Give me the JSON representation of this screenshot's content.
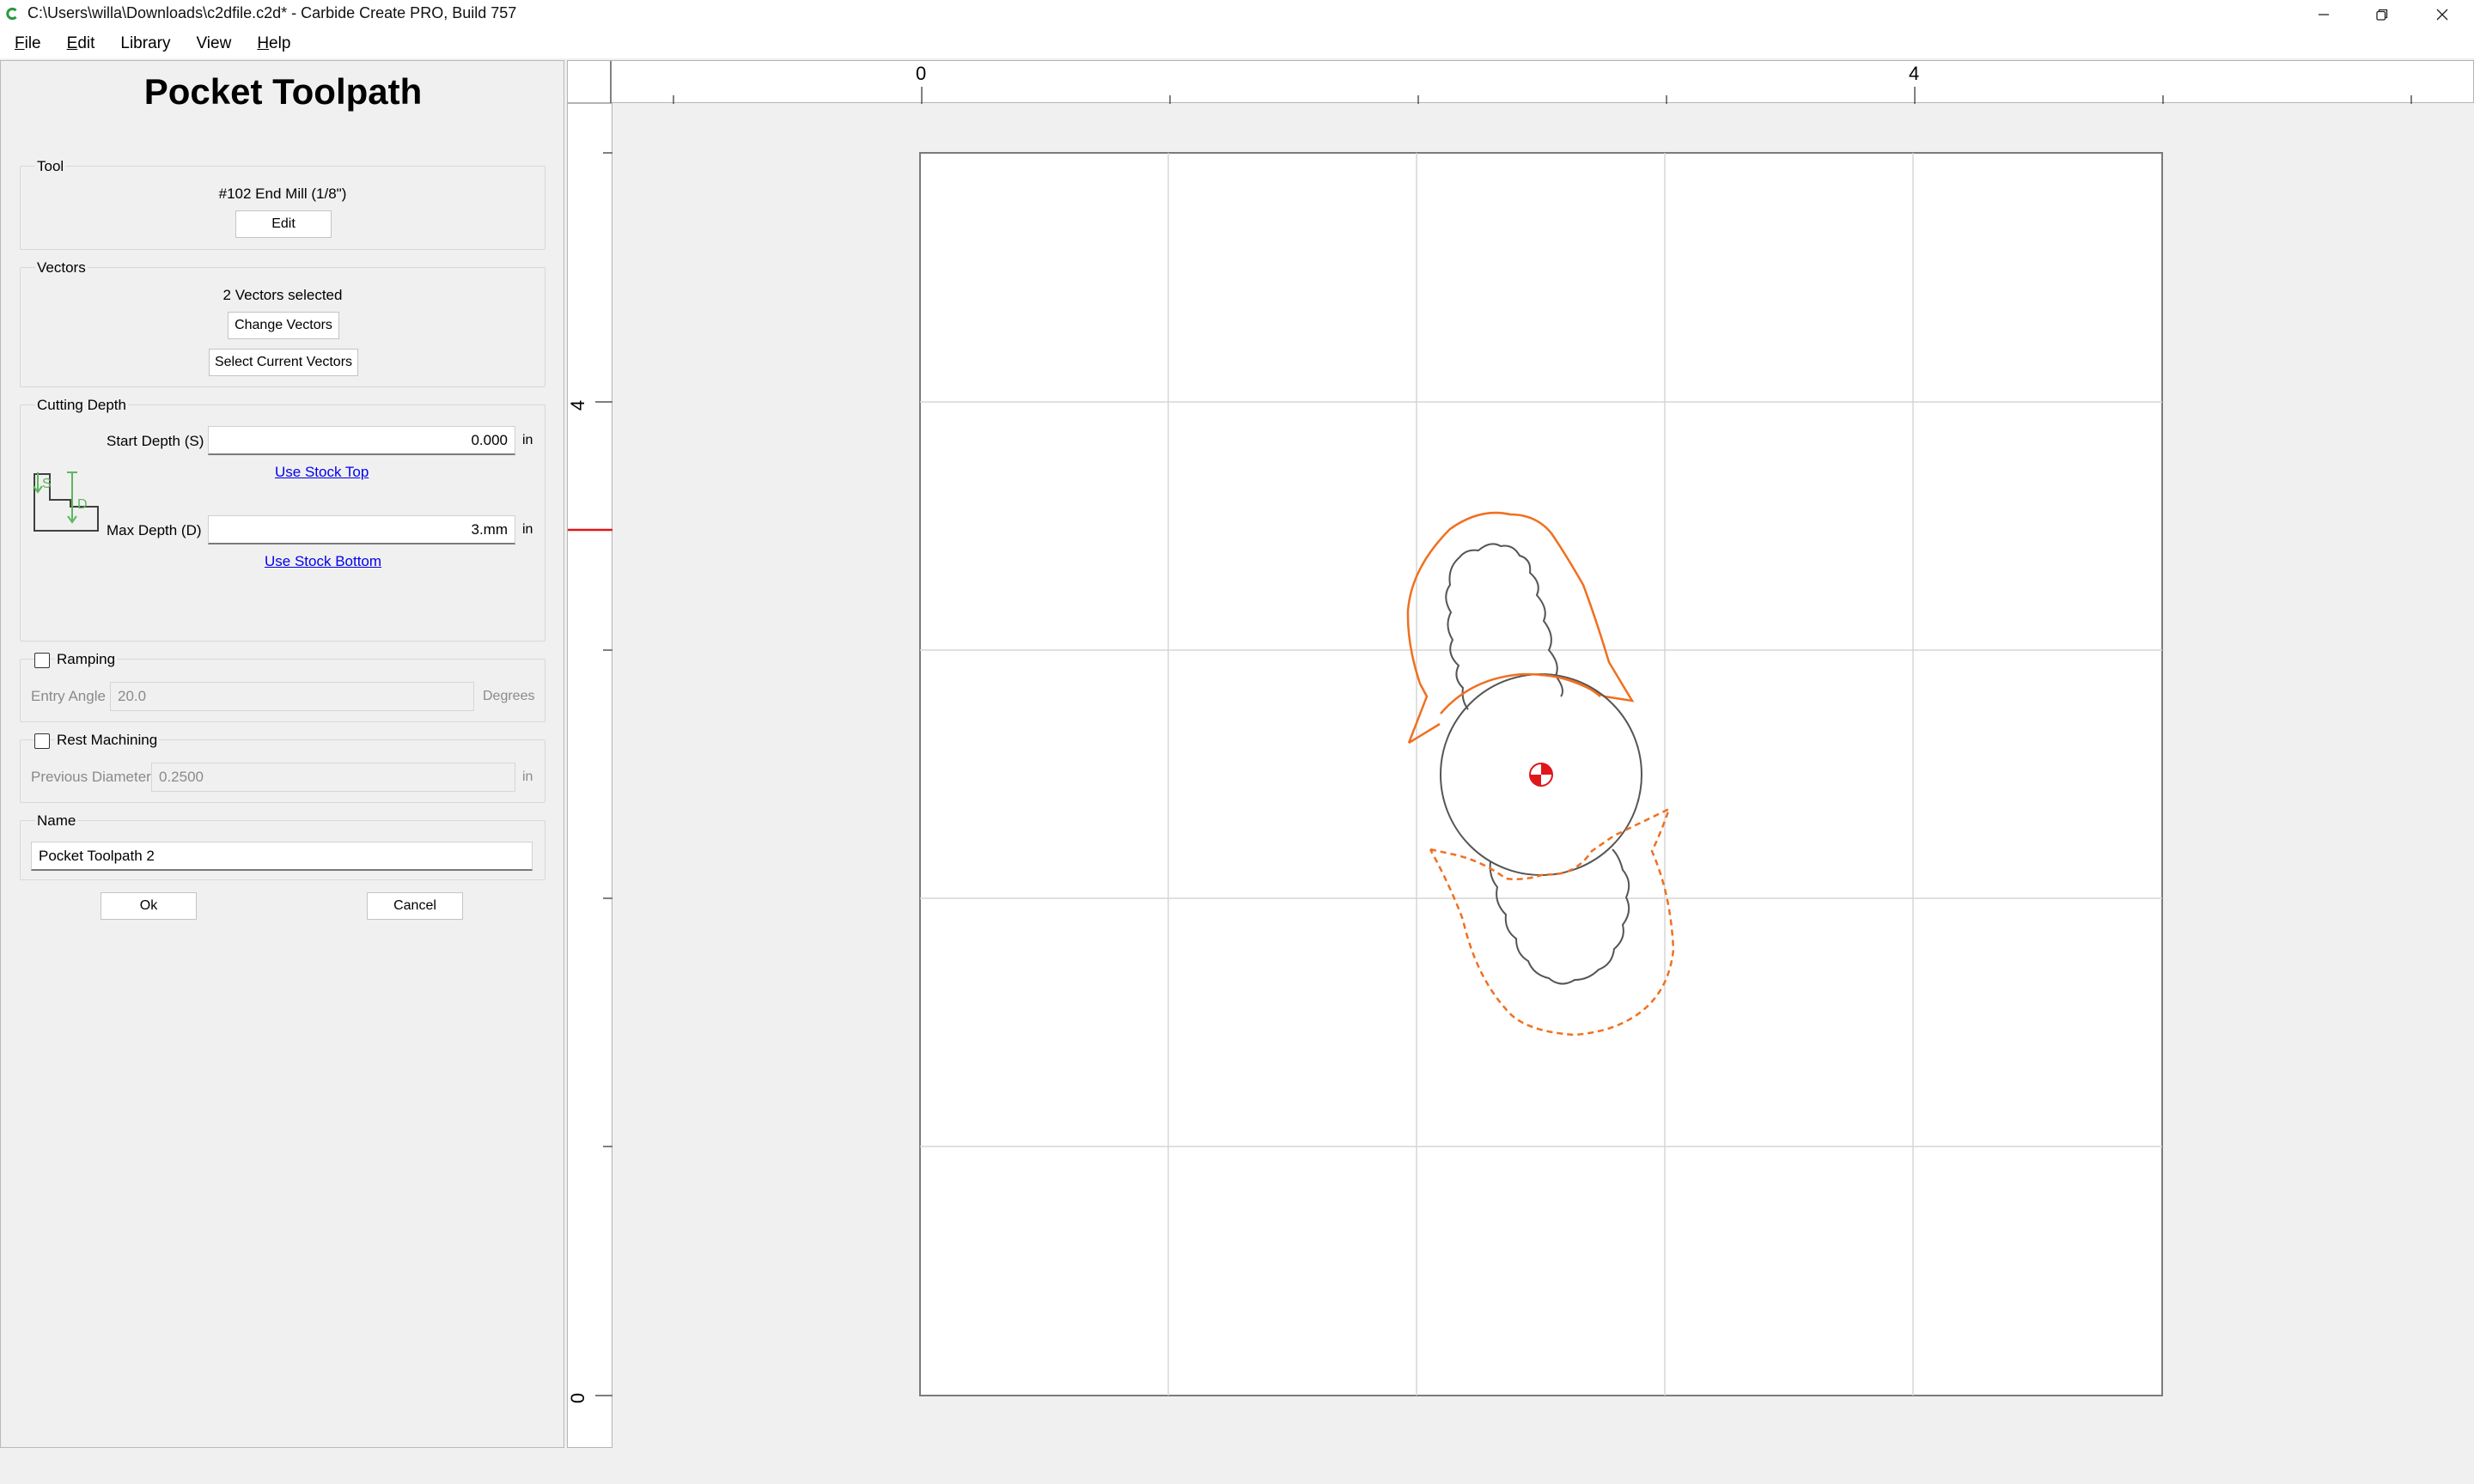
{
  "window": {
    "title": "C:\\Users\\willa\\Downloads\\c2dfile.c2d* - Carbide Create PRO, Build 757",
    "controls": [
      "minimize-icon",
      "restore-icon",
      "close-icon"
    ],
    "accent_color": "#2b9a3d"
  },
  "menu": {
    "items": [
      {
        "mnemonic": "F",
        "rest": "ile"
      },
      {
        "mnemonic": "E",
        "rest": "dit"
      },
      {
        "mnemonic": "",
        "rest": "Library"
      },
      {
        "mnemonic": "",
        "rest": "View"
      },
      {
        "mnemonic": "H",
        "rest": "elp"
      }
    ]
  },
  "panel": {
    "title": "Pocket Toolpath",
    "tool": {
      "label": "Tool",
      "name": "#102 End Mill (1/8\")",
      "edit_button": "Edit"
    },
    "vectors": {
      "label": "Vectors",
      "selected_text": "2 Vectors selected",
      "change_button": "Change Vectors",
      "select_button": "Select Current Vectors"
    },
    "cutting_depth": {
      "label": "Cutting Depth",
      "start_label": "Start Depth (S)",
      "start_value": "0.000",
      "start_unit": "in",
      "use_stock_top": "Use Stock Top",
      "max_label": "Max Depth (D)",
      "max_value": "3.mm",
      "max_unit": "in",
      "use_stock_bottom": "Use Stock Bottom",
      "diagram_s": "S",
      "diagram_d": "D"
    },
    "ramping": {
      "label": "Ramping",
      "checked": false,
      "entry_angle_label": "Entry Angle",
      "entry_angle_value": "20.0",
      "entry_angle_unit": "Degrees"
    },
    "rest_machining": {
      "label": "Rest Machining",
      "checked": false,
      "previous_diameter_label": "Previous Diameter",
      "previous_diameter_value": "0.2500",
      "previous_diameter_unit": "in"
    },
    "name": {
      "label": "Name",
      "value": "Pocket Toolpath 2"
    },
    "ok_button": "Ok",
    "cancel_button": "Cancel"
  },
  "rulers": {
    "top_labels": [
      "0",
      "4"
    ],
    "left_labels": [
      "4",
      "0"
    ]
  },
  "canvas": {
    "toolpath_color": "#f07020",
    "vector_color": "#555555",
    "grid_color": "#d0d0d0",
    "origin_marker_color": "#e0161b"
  }
}
